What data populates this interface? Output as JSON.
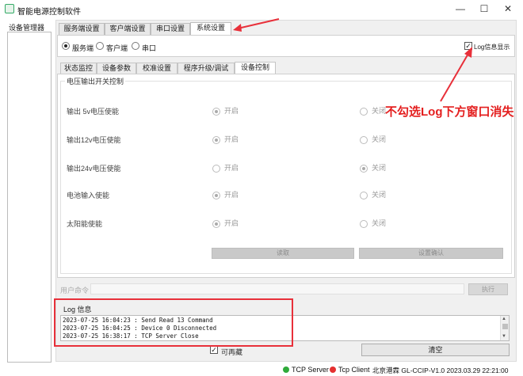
{
  "window": {
    "title": "智能电源控制软件",
    "minimize": "—",
    "maximize": "☐",
    "close": "✕"
  },
  "left_panel": {
    "label": "设备管理器"
  },
  "top_tabs": [
    {
      "label": "服务端设置"
    },
    {
      "label": "客户端设置"
    },
    {
      "label": "串口设置"
    },
    {
      "label": "系统设置"
    }
  ],
  "mode": {
    "options": [
      "服务端",
      "客户端",
      "串口"
    ],
    "selected": "服务端",
    "log_checkbox_label": "Log信息显示",
    "log_checkbox_checked": true
  },
  "sub_tabs": [
    {
      "label": "状态监控"
    },
    {
      "label": "设备参数"
    },
    {
      "label": "校准设置"
    },
    {
      "label": "程序升级/调试"
    },
    {
      "label": "设备控制"
    }
  ],
  "group": {
    "title": "电压输出开关控制",
    "on_label": "开启",
    "off_label": "关闭",
    "rows": [
      {
        "label": "输出 5v电压使能",
        "selected": "on"
      },
      {
        "label": "输出12v电压使能",
        "selected": "on"
      },
      {
        "label": "输出24v电压使能",
        "selected": "off"
      },
      {
        "label": "电池输入使能",
        "selected": "on"
      },
      {
        "label": "太阳能使能",
        "selected": "on"
      }
    ],
    "read_button": "读取",
    "confirm_button": "设置确认"
  },
  "annotation": "不勾选Log下方窗口消失",
  "command": {
    "label": "用户命令",
    "value": "",
    "execute_button": "执行"
  },
  "log": {
    "title": "Log 信息",
    "lines": [
      "2023-07-25 16:04:23 : Send Read 13 Command",
      "2023-07-25 16:04:25 : Device 0 Disconnected",
      "2023-07-25 16:38:17 : TCP Server Close"
    ],
    "checkbox_label": "可再藏",
    "clear_button": "清空"
  },
  "statusbar": {
    "tcp_server": "TCP Server",
    "tcp_client": "Tcp Client",
    "info": "北京港霖 GL-CCIP-V1.0 2023.03.29 22:21:00",
    "colors": {
      "server": "#2faa3a",
      "client": "#e53030",
      "annotation": "#e41f1f"
    }
  }
}
